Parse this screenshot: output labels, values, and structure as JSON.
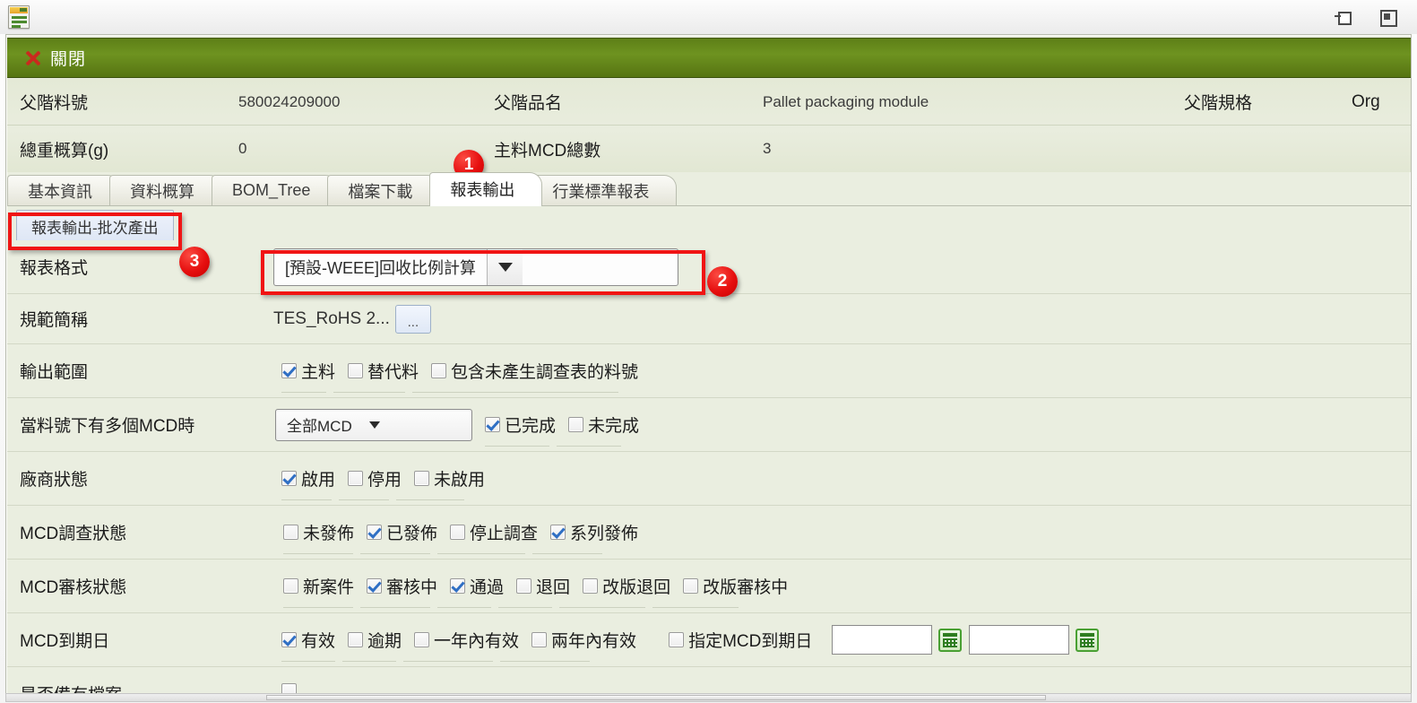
{
  "window": {
    "app_icon": "form-document-icon",
    "pin_button": "pin-window-icon",
    "maximize_button": "maximize-window-icon"
  },
  "command_bar": {
    "close_label": "關閉",
    "close_icon": "red-x-icon",
    "bar_color": "#6e9320"
  },
  "info_header": {
    "rows": [
      {
        "label1": "父階料號",
        "value1": "580024209000",
        "label2": "父階品名",
        "value2": "Pallet packaging module",
        "label3": "父階規格",
        "value3": "Org"
      },
      {
        "label1": "總重概算(g)",
        "value1": "0",
        "label2": "主料MCD總數",
        "value2": "3",
        "label3": "",
        "value3": ""
      }
    ]
  },
  "tabs": [
    {
      "label": "基本資訊",
      "active": false
    },
    {
      "label": "資料概算",
      "active": false
    },
    {
      "label": "BOM_Tree",
      "active": false
    },
    {
      "label": "檔案下載",
      "active": false
    },
    {
      "label": "報表輸出",
      "active": true
    },
    {
      "label": "行業標準報表",
      "active": false
    }
  ],
  "subtab": {
    "label": "報表輸出-批次產出"
  },
  "form": {
    "report_format": {
      "label": "報表格式",
      "value": "[預設-WEEE]回收比例計算",
      "arrow_icon": "chevron-down-icon"
    },
    "spec_name": {
      "label": "規範簡稱",
      "value": "TES_RoHS 2...",
      "browse_button": "..."
    },
    "output_scope": {
      "label": "輸出範圍",
      "options": [
        {
          "label": "主料",
          "checked": true
        },
        {
          "label": "替代料",
          "checked": false
        },
        {
          "label": "包含未產生調查表的料號",
          "checked": false
        }
      ]
    },
    "multi_mcd": {
      "label": "當料號下有多個MCD時",
      "select_value": "全部MCD",
      "options": [
        {
          "label": "已完成",
          "checked": true
        },
        {
          "label": "未完成",
          "checked": false
        }
      ]
    },
    "vendor_status": {
      "label": "廠商狀態",
      "options": [
        {
          "label": "啟用",
          "checked": true
        },
        {
          "label": "停用",
          "checked": false
        },
        {
          "label": "未啟用",
          "checked": false
        }
      ]
    },
    "mcd_survey_status": {
      "label": "MCD調查狀態",
      "options": [
        {
          "label": "未發佈",
          "checked": false
        },
        {
          "label": "已發佈",
          "checked": true
        },
        {
          "label": "停止調查",
          "checked": false
        },
        {
          "label": "系列發佈",
          "checked": true
        }
      ]
    },
    "mcd_audit_status": {
      "label": "MCD審核狀態",
      "options": [
        {
          "label": "新案件",
          "checked": false
        },
        {
          "label": "審核中",
          "checked": true
        },
        {
          "label": "通過",
          "checked": true
        },
        {
          "label": "退回",
          "checked": false
        },
        {
          "label": "改版退回",
          "checked": false
        },
        {
          "label": "改版審核中",
          "checked": false
        }
      ]
    },
    "mcd_expire": {
      "label": "MCD到期日",
      "options": [
        {
          "label": "有效",
          "checked": true
        },
        {
          "label": "逾期",
          "checked": false
        },
        {
          "label": "一年內有效",
          "checked": false
        },
        {
          "label": "兩年內有效",
          "checked": false
        }
      ],
      "specify": {
        "label": "指定MCD到期日",
        "checked": false
      },
      "date_from": "",
      "date_to": "",
      "calendar_icon": "calendar-icon"
    },
    "attachment": {
      "label": "是否備有檔案",
      "checked": false
    }
  },
  "annotations": [
    {
      "number": "1"
    },
    {
      "number": "2"
    },
    {
      "number": "3"
    }
  ]
}
